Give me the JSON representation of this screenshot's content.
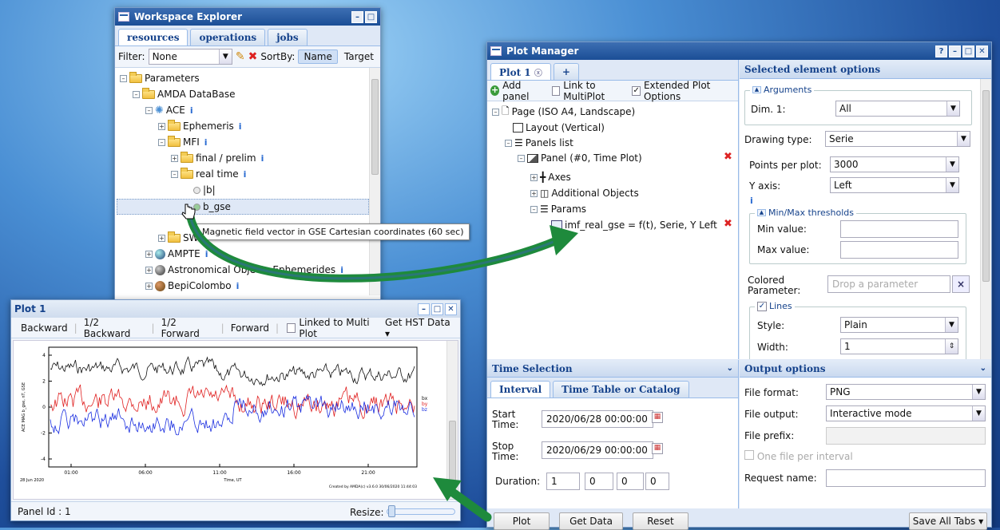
{
  "workspace": {
    "title": "Workspace Explorer",
    "tabs": [
      "resources",
      "operations",
      "jobs"
    ],
    "filter_label": "Filter:",
    "filter_value": "None",
    "sortby_label": "SortBy:",
    "sort_name": "Name",
    "sort_target": "Target",
    "tree": {
      "parameters": "Parameters",
      "amda": "AMDA DataBase",
      "ace": "ACE",
      "ephemeris": "Ephemeris",
      "mfi": "MFI",
      "final": "final / prelim",
      "realtime": "real time",
      "b": "|b|",
      "bgse": "b_gse",
      "swe": "SW",
      "ampte": "AMPTE",
      "astro": "Astronomical Objects Ephemerides",
      "bepi": "BepiColombo"
    },
    "info": "i",
    "tooltip": "Magnetic field vector in GSE Cartesian coordinates (60 sec)"
  },
  "plotmanager": {
    "title": "Plot Manager",
    "tab": "Plot 1",
    "tab_add": "+",
    "add_panel": "Add panel",
    "link_multiplot": "Link to MultiPlot",
    "extended": "Extended Plot Options",
    "tree": {
      "page": "Page (ISO A4, Landscape)",
      "layout": "Layout (Vertical)",
      "panels": "Panels list",
      "panel": "Panel (#0, Time Plot)",
      "axes": "Axes",
      "objects": "Additional Objects",
      "params": "Params",
      "param": "imf_real_gse = f(t), Serie, Y Left"
    },
    "options": {
      "header": "Selected element options",
      "arguments": "Arguments",
      "dim_label": "Dim. 1:",
      "dim_value": "All",
      "drawing_label": "Drawing type:",
      "drawing_value": "Serie",
      "points_label": "Points per plot:",
      "points_value": "3000",
      "yaxis_label": "Y axis:",
      "yaxis_value": "Left",
      "minmax": "Min/Max thresholds",
      "min_label": "Min value:",
      "max_label": "Max value:",
      "colored_label": "Colored Parameter:",
      "colored_placeholder": "Drop a parameter",
      "lines": "Lines",
      "style_label": "Style:",
      "style_value": "Plain",
      "width_label": "Width:",
      "width_value": "1"
    },
    "time": {
      "header": "Time Selection",
      "tab_interval": "Interval",
      "tab_table": "Time Table or Catalog",
      "start_label": "Start Time:",
      "start_value": "2020/06/28 00:00:00",
      "stop_label": "Stop Time:",
      "stop_value": "2020/06/29 00:00:00",
      "duration_label": "Duration:",
      "duration": [
        "1",
        "0",
        "0",
        "0"
      ]
    },
    "output": {
      "header": "Output options",
      "format_label": "File format:",
      "format_value": "PNG",
      "output_label": "File output:",
      "output_value": "Interactive mode",
      "prefix_label": "File prefix:",
      "one_file": "One file per interval",
      "request_label": "Request name:"
    },
    "buttons": {
      "plot": "Plot",
      "getdata": "Get Data",
      "reset": "Reset",
      "saveall": "Save All Tabs"
    }
  },
  "plot1": {
    "title": "Plot 1",
    "nav": [
      "Backward",
      "1/2 Backward",
      "1/2 Forward",
      "Forward"
    ],
    "linked": "Linked to Multi Plot",
    "hst": "Get HST Data",
    "panel_id": "Panel Id : 1",
    "resize": "Resize:",
    "credit": "Created by AMDA(c) v3.6.0 30/06/2020 11:44:03",
    "date_label": "28 Jun 2020",
    "ylabel": "ACE MAG b_gse, nT, GSE",
    "xlabel": "Time, UT",
    "xticks": [
      "01:00",
      "06:00",
      "11:00",
      "16:00",
      "21:00"
    ],
    "yticks": [
      "4",
      "2",
      "0",
      "-2",
      "-4"
    ],
    "legend": [
      "bx",
      "by",
      "bz"
    ]
  },
  "colors": {
    "bx": "#111111",
    "by": "#e02020",
    "bz": "#1a2ee0",
    "arrow": "#1e8a3c"
  }
}
